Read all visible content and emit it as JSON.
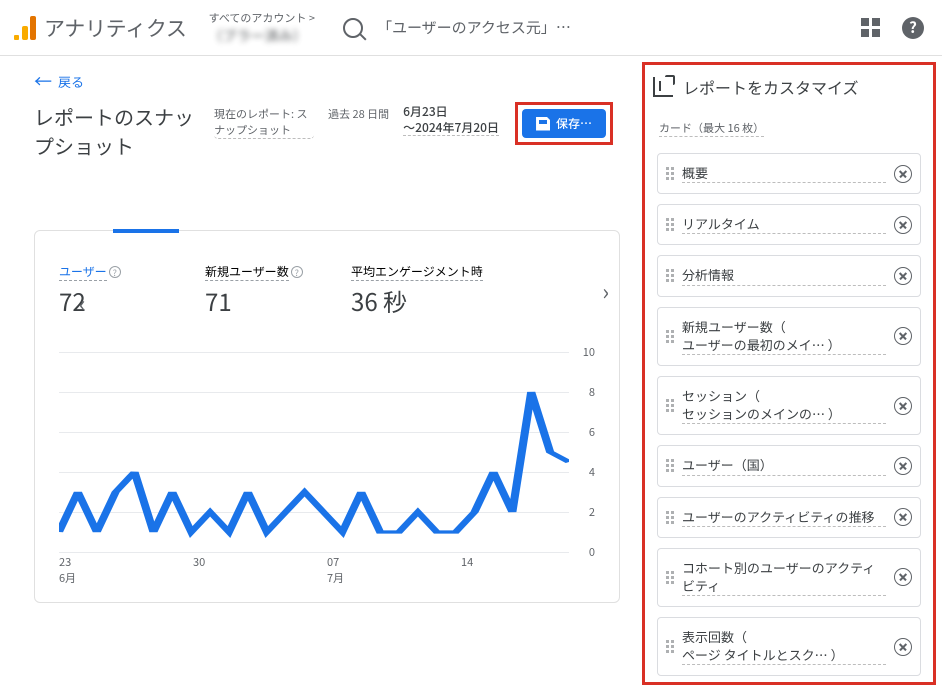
{
  "header": {
    "app_name": "アナリティクス",
    "breadcrumb_top": "すべてのアカウント >",
    "breadcrumb_bottom": "（ブラー済み）",
    "search_placeholder": "「ユーザーのアクセス元」…"
  },
  "left_pane": {
    "back_label": "戻る",
    "page_title": "レポートのスナップショット",
    "status_pill": "現在のレポート: スナップショット",
    "date_note": "過去 28 日間",
    "date_range": "6月23日\n～2024年7月20日",
    "save_label": "保存…",
    "metrics": [
      {
        "label": "ユーザー",
        "value": "72",
        "active": true
      },
      {
        "label": "新規ユーザー数",
        "value": "71",
        "active": false
      },
      {
        "label": "平均エンゲージメント時",
        "value": "36 秒",
        "active": false
      }
    ],
    "x_ticks": [
      "23\n6月",
      "30",
      "07\n7月",
      "14"
    ]
  },
  "chart_data": {
    "type": "line",
    "xlabel": "",
    "ylabel": "",
    "ylim": [
      0,
      10
    ],
    "y_ticks": [
      0,
      2,
      4,
      6,
      8,
      10
    ],
    "categories": [
      "6/23",
      "6/24",
      "6/25",
      "6/26",
      "6/27",
      "6/28",
      "6/29",
      "6/30",
      "7/1",
      "7/2",
      "7/3",
      "7/4",
      "7/5",
      "7/6",
      "7/7",
      "7/8",
      "7/9",
      "7/10",
      "7/11",
      "7/12",
      "7/13",
      "7/14",
      "7/15",
      "7/16",
      "7/17",
      "7/18",
      "7/19",
      "7/20"
    ],
    "series": [
      {
        "name": "ユーザー",
        "values": [
          1,
          3,
          1,
          3,
          4,
          1,
          3,
          1,
          2,
          1,
          3,
          1,
          2,
          3,
          2,
          1,
          3,
          1,
          1,
          2,
          1,
          1,
          2,
          4,
          2,
          8,
          5,
          4.5
        ]
      }
    ]
  },
  "right_panel": {
    "title": "レポートをカスタマイズ",
    "card_max": "カード（最大 16 枚）",
    "cards": [
      "概要",
      "リアルタイム",
      "分析情報",
      "新規ユーザー数（\nユーザーの最初のメイ… ）",
      "セッション（\nセッションのメインの… ）",
      "ユーザー（国）",
      "ユーザーのアクティビティの推移",
      "コホート別のユーザーのアクティビティ",
      "表示回数（\nページ タイトルとスク… ）"
    ]
  }
}
